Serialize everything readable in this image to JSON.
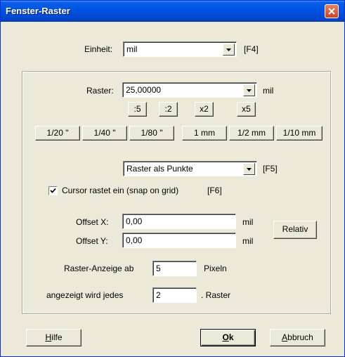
{
  "window": {
    "title": "Fenster-Raster"
  },
  "unit": {
    "label": "Einheit:",
    "value": "mil",
    "shortcut": "[F4]"
  },
  "grid": {
    "label": "Raster:",
    "value": "25,00000",
    "unit": "mil",
    "factor_buttons": [
      ":5",
      ":2",
      "x2",
      "x5"
    ],
    "preset_buttons": [
      "1/20 \"",
      "1/40 \"",
      "1/80 \"",
      "1 mm",
      "1/2 mm",
      "1/10 mm"
    ]
  },
  "display_mode": {
    "value": "Raster als Punkte",
    "shortcut": "[F5]"
  },
  "snap": {
    "checked": true,
    "label": "Cursor rastet ein (snap on grid)",
    "shortcut": "[F6]"
  },
  "offset": {
    "x_label": "Offset X:",
    "x_value": "0,00",
    "x_unit": "mil",
    "y_label": "Offset Y:",
    "y_value": "0,00",
    "y_unit": "mil",
    "relative_button": "Relativ"
  },
  "display_from": {
    "label": "Raster-Anzeige ab",
    "value": "5",
    "unit": "Pixeln"
  },
  "shown_every": {
    "label": "angezeigt wird jedes",
    "value": "2",
    "unit": ". Raster"
  },
  "footer": {
    "help_first": "H",
    "help_rest": "ilfe",
    "ok_first": "O",
    "ok_rest": "k",
    "cancel_first": "A",
    "cancel_rest": "bbruch"
  }
}
